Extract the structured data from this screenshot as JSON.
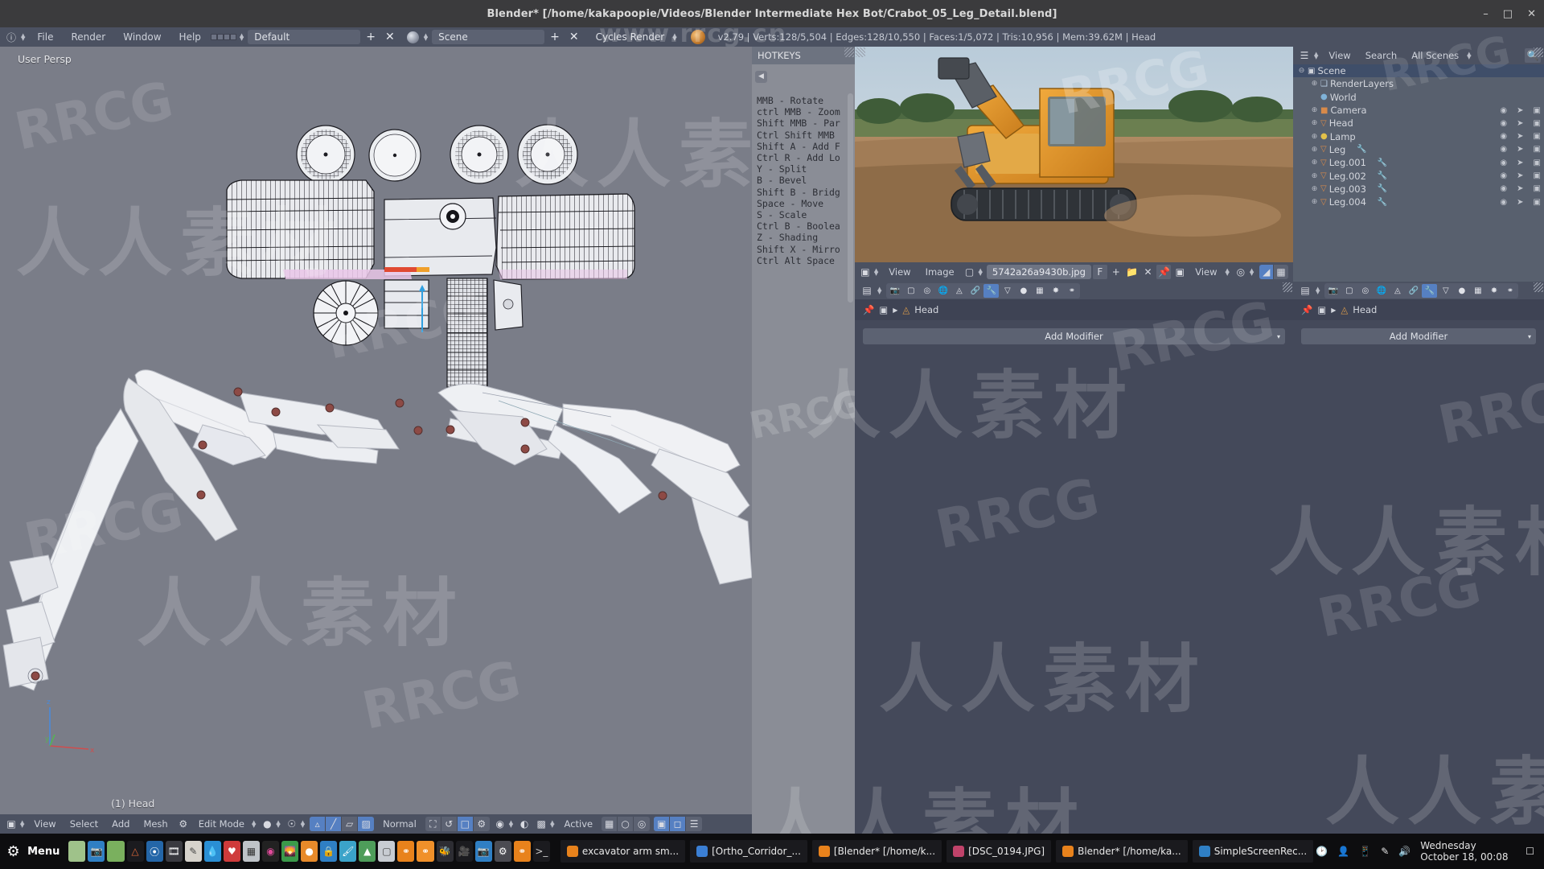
{
  "window": {
    "title": "Blender* [/home/kakapoopie/Videos/Blender Intermediate Hex Bot/Crabot_05_Leg_Detail.blend]",
    "minimize": "–",
    "maximize": "□",
    "close": "✕"
  },
  "topbar": {
    "info_icon": "info-icon",
    "menus": [
      "File",
      "Render",
      "Window",
      "Help"
    ],
    "screen_layout": "Default",
    "scene_name": "Scene",
    "engine": "Cycles Render",
    "add_label": "+",
    "remove_label": "✕",
    "stats": "v2.79 | Verts:128/5,504 | Edges:128/10,550 | Faces:1/5,072 | Tris:10,956 | Mem:39.62M | Head"
  },
  "viewport": {
    "view_label": "User Persp",
    "active_object": "(1) Head",
    "axis_x": "x",
    "axis_y": "y",
    "axis_z": "z",
    "footer": {
      "menus": [
        "View",
        "Select",
        "Add",
        "Mesh"
      ],
      "mode": "Edit Mode",
      "orientation": "Normal",
      "pivot": "Active"
    }
  },
  "text_editor": {
    "header_title": "HOTKEYS",
    "lines": [
      "MMB - Rotate",
      "ctrl MMB - Zoom",
      "Shift MMB - Par",
      "Ctrl Shift MMB",
      "Shift A - Add F",
      "Ctrl R - Add Lo",
      "Y - Split",
      "B - Bevel",
      "Shift B - Bridg",
      "Space - Move",
      "S - Scale",
      "Ctrl B - Boolea",
      "Z - Shading",
      "Shift X - Mirro",
      "Ctrl Alt Space"
    ]
  },
  "image_editor": {
    "menus": [
      "View",
      "Image"
    ],
    "image_name": "5742a26a9430b.jpg",
    "fake_user": "F",
    "new_label": "+",
    "open_label": "open-icon",
    "unlink_label": "✕",
    "pin_label": "pin-icon",
    "view_mode": "View"
  },
  "outliner": {
    "menus": [
      "View",
      "Search"
    ],
    "display_mode": "All Scenes",
    "rows": [
      {
        "name": "Scene",
        "indent": 0,
        "icon": "scene-icon",
        "selected": true,
        "expander": "⊖",
        "has_visibility": false,
        "has_wrench": false
      },
      {
        "name": "RenderLayers",
        "indent": 1,
        "icon": "renderlayer-icon",
        "selected": false,
        "expander": "⊕",
        "has_visibility": false,
        "has_wrench": false
      },
      {
        "name": "World",
        "indent": 1,
        "icon": "world-icon",
        "selected": false,
        "expander": "",
        "has_visibility": false,
        "has_wrench": false
      },
      {
        "name": "Camera",
        "indent": 1,
        "icon": "camera-icon",
        "selected": false,
        "expander": "⊕",
        "has_visibility": true,
        "has_wrench": false
      },
      {
        "name": "Head",
        "indent": 1,
        "icon": "mesh-icon",
        "selected": false,
        "expander": "⊕",
        "has_visibility": true,
        "has_wrench": false
      },
      {
        "name": "Lamp",
        "indent": 1,
        "icon": "lamp-icon",
        "selected": false,
        "expander": "⊕",
        "has_visibility": true,
        "has_wrench": false
      },
      {
        "name": "Leg",
        "indent": 1,
        "icon": "mesh-icon",
        "selected": false,
        "expander": "⊕",
        "has_visibility": true,
        "has_wrench": true
      },
      {
        "name": "Leg.001",
        "indent": 1,
        "icon": "mesh-icon",
        "selected": false,
        "expander": "⊕",
        "has_visibility": true,
        "has_wrench": true
      },
      {
        "name": "Leg.002",
        "indent": 1,
        "icon": "mesh-icon",
        "selected": false,
        "expander": "⊕",
        "has_visibility": true,
        "has_wrench": true
      },
      {
        "name": "Leg.003",
        "indent": 1,
        "icon": "mesh-icon",
        "selected": false,
        "expander": "⊕",
        "has_visibility": true,
        "has_wrench": true
      },
      {
        "name": "Leg.004",
        "indent": 1,
        "icon": "mesh-icon",
        "selected": false,
        "expander": "⊕",
        "has_visibility": true,
        "has_wrench": true
      }
    ]
  },
  "properties_left": {
    "breadcrumb_object": "Head",
    "add_modifier": "Add Modifier"
  },
  "properties_right": {
    "breadcrumb_object": "Head",
    "add_modifier": "Add Modifier"
  },
  "taskbar": {
    "menu_label": "Menu",
    "windows": [
      {
        "label": "excavator arm sm...",
        "color": "#e8821c"
      },
      {
        "label": "[Ortho_Corridor_...",
        "color": "#3b7fd4"
      },
      {
        "label": "[Blender* [/home/k...",
        "color": "#e8821c"
      },
      {
        "label": "[DSC_0194.JPG]",
        "color": "#c0436a"
      },
      {
        "label": "Blender* [/home/ka...",
        "color": "#e8821c"
      },
      {
        "label": "SimpleScreenRec...",
        "color": "#2f7fc4"
      }
    ],
    "clock": "Wednesday October 18, 00:08"
  },
  "watermarks": {
    "site": "www.rrcg.cn",
    "brand": "RRCG",
    "cn": "人人素材"
  },
  "colors": {
    "header": "#4b5161",
    "viewport_bg": "#7a7d88",
    "accent_blue": "#5680c2",
    "panel_bg": "#44495a",
    "outliner_bg": "#58606e",
    "text_editor_bg": "#8a8d96",
    "taskbar_bg": "#0d0d0f"
  }
}
